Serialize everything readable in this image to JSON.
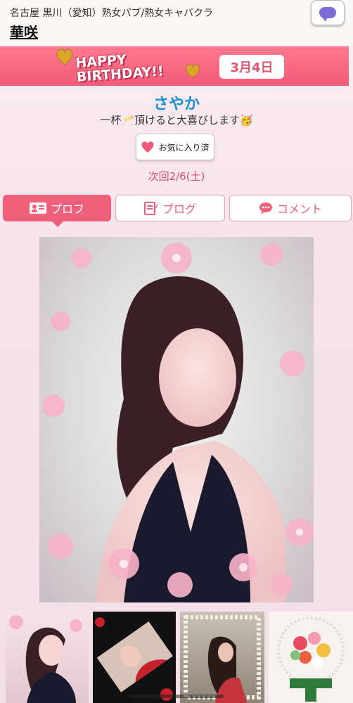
{
  "header": {
    "location": "名古屋 黒川（愛知）熟女パブ/熟女キャバクラ",
    "shop_name": "華咲",
    "chat_icon": "chat-bubble-icon"
  },
  "birthday_banner": {
    "text_line1": "HAPPY",
    "text_line2": "BIRTHDAY!!",
    "date": "3月4日"
  },
  "profile": {
    "name": "さやか",
    "message": "一杯🥂頂けると大喜びします🥳",
    "favorite_label": "お気に入り済",
    "next_shift": "次回2/6(土)"
  },
  "tabs": [
    {
      "label": "プロフ",
      "icon": "profile-card-icon",
      "active": true
    },
    {
      "label": "ブログ",
      "icon": "blog-edit-icon",
      "active": false
    },
    {
      "label": "コメント",
      "icon": "comment-bubble-icon",
      "active": false
    }
  ],
  "colors": {
    "accent": "#f0607a",
    "name": "#1a8fd0",
    "chat": "#7b6ad8"
  }
}
